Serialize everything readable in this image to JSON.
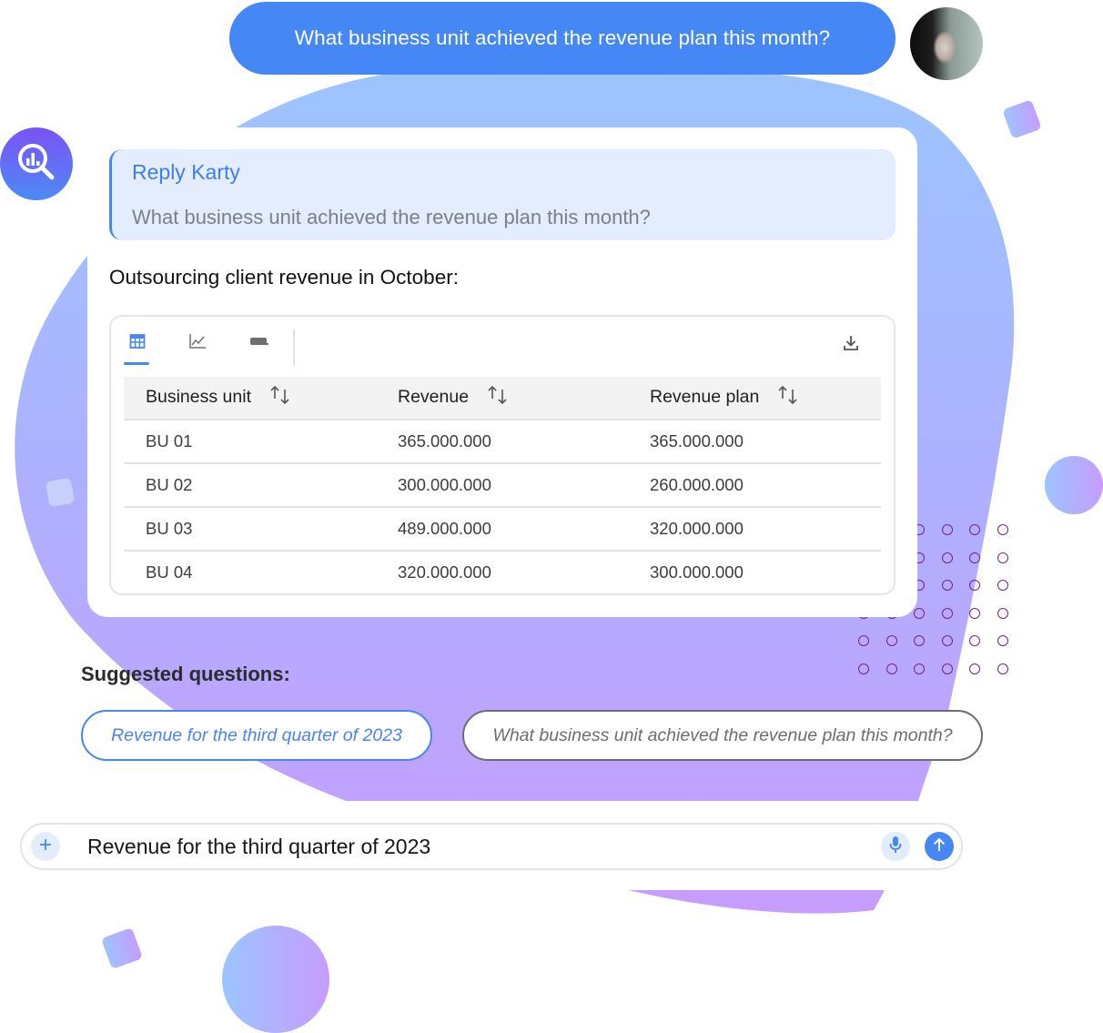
{
  "colors": {
    "accent": "#4587f4",
    "reply_bg": "#e3edfd",
    "dot_color": "#7a2379",
    "blob_top": "#9cc5ff",
    "blob_bottom": "#c79cff"
  },
  "user_message": {
    "text": "What business unit achieved the revenue plan this month?",
    "avatar": "user-avatar-photo"
  },
  "bot": {
    "logo_icon": "search-analytics-icon"
  },
  "response": {
    "reply_title": "Reply Karty",
    "reply_quote": "What business unit achieved the revenue plan this month?",
    "answer_text": "Outsourcing client revenue in October:",
    "tabs": [
      {
        "name": "table",
        "icon": "table-icon",
        "active": true
      },
      {
        "name": "chart",
        "icon": "line-chart-icon",
        "active": false
      },
      {
        "name": "sql",
        "icon": "sql-icon",
        "active": false
      }
    ],
    "download_icon": "download-icon",
    "table": {
      "columns": [
        "Business unit",
        "Revenue",
        "Revenue plan"
      ],
      "rows": [
        [
          "BU 01",
          "365.000.000",
          "365.000.000"
        ],
        [
          "BU 02",
          "300.000.000",
          "260.000.000"
        ],
        [
          "BU 03",
          "489.000.000",
          "320.000.000"
        ],
        [
          "BU 04",
          "320.000.000",
          "300.000.000"
        ]
      ]
    }
  },
  "suggested": {
    "title": "Suggested questions:",
    "chips": [
      "Revenue for the third quarter of 2023",
      "What business unit achieved the revenue plan this month?"
    ]
  },
  "input": {
    "value": "Revenue for the third quarter of 2023",
    "plus_icon": "plus-icon",
    "mic_icon": "microphone-icon",
    "send_icon": "send-arrow-up-icon"
  }
}
